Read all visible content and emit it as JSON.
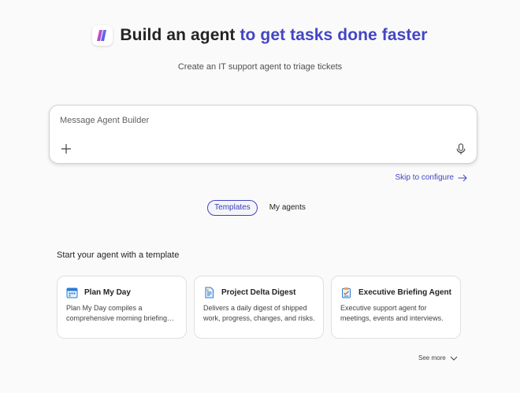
{
  "hero": {
    "title_main": "Build an agent",
    "title_accent": "to get tasks done faster",
    "subtitle": "Create an IT support agent to triage tickets"
  },
  "composer": {
    "placeholder": "Message Agent Builder",
    "value": ""
  },
  "skip_link": "Skip to configure",
  "tabs": [
    {
      "label": "Templates",
      "active": true
    },
    {
      "label": "My agents",
      "active": false
    }
  ],
  "templates": {
    "heading": "Start your agent with a template",
    "cards": [
      {
        "title": "Plan My Day",
        "description": "Plan My Day compiles a comprehensive morning briefing…",
        "icon": "calendar-icon"
      },
      {
        "title": "Project Delta Digest",
        "description": "Delivers a daily digest of shipped work, progress, changes, and risks.",
        "icon": "document-icon"
      },
      {
        "title": "Executive Briefing Agent",
        "description": "Executive support agent for meetings, events and interviews.",
        "icon": "clipboard-icon"
      }
    ],
    "see_more": "See more"
  },
  "colors": {
    "accent": "#4346c2",
    "background": "#fafafa"
  }
}
